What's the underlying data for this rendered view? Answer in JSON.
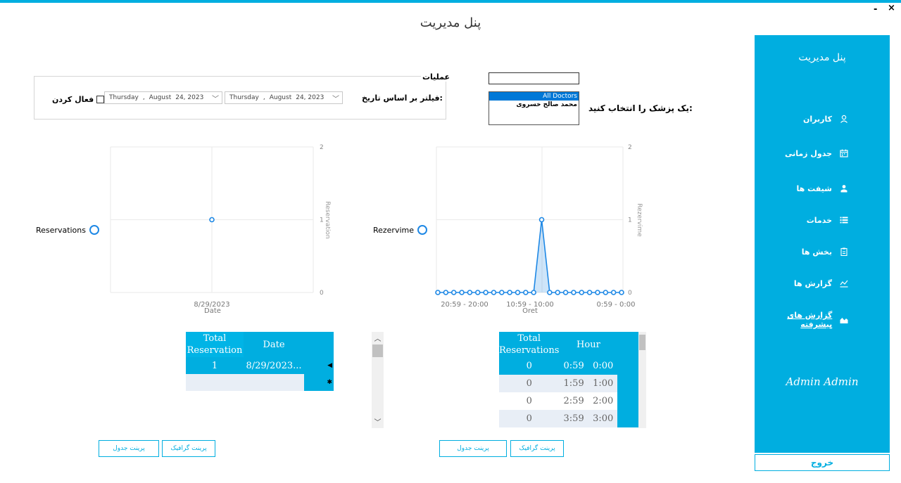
{
  "window": {
    "title": "پنل مدیریت",
    "minimize": "-",
    "close": "×"
  },
  "sidebar": {
    "title": "پنل مدیریت",
    "items": [
      {
        "label": "کاربران",
        "icon": "user-icon"
      },
      {
        "label": "جدول زمانی",
        "icon": "calendar-icon"
      },
      {
        "label": "شیفت ها",
        "icon": "doctor-icon"
      },
      {
        "label": "خدمات",
        "icon": "list-icon"
      },
      {
        "label": "بخش ها",
        "icon": "clipboard-icon"
      },
      {
        "label": "گزارش ها",
        "icon": "line-chart-icon"
      },
      {
        "label": "گزارش های پیشرفته",
        "icon": "area-chart-icon"
      }
    ],
    "user_name": "Admin Admin",
    "logout": "خروج"
  },
  "filter": {
    "legend": "عملیات",
    "label": "فیلتر بر اساس تاریخ:",
    "from": {
      "day": "Thursday",
      "sep": ",",
      "month": "August",
      "date": "24, 2023"
    },
    "to": {
      "day": "Thursday",
      "sep": ",",
      "month": "August",
      "date": "24, 2023"
    },
    "enable_label": "فعال کردن"
  },
  "doctor_select": {
    "label": "یک پزشک را انتخاب کنید:",
    "search_value": "",
    "options": [
      "All Doctors",
      "محمد صالح خسروی"
    ],
    "selected": "All Doctors"
  },
  "chart_data": [
    {
      "type": "scatter",
      "x": [
        "8/29/2023"
      ],
      "y": [
        1
      ],
      "xlabel": "Date",
      "ylabel": "Reservation",
      "ylim": [
        0,
        2
      ],
      "yticks": [
        "0",
        "1",
        "2"
      ],
      "series": [
        {
          "name": "Reservations",
          "values": [
            1
          ]
        }
      ],
      "legend": "left",
      "grid": true
    },
    {
      "type": "area",
      "categories": [
        "20:59 - 20:00",
        "10:59 - 10:00",
        "0:59 - 0:00"
      ],
      "x_labels_shown": [
        "20:59 - 20:00",
        "10:59 - 10:00",
        "0:59 - 0:00"
      ],
      "values": [
        0,
        0,
        0,
        0,
        0,
        0,
        0,
        0,
        0,
        0,
        0,
        0,
        0,
        1,
        0,
        0,
        0,
        0,
        0,
        0,
        0,
        0,
        0,
        0
      ],
      "xlabel": "Oret",
      "ylabel": "Rezervime",
      "ylim": [
        0,
        2
      ],
      "yticks": [
        "0",
        "1",
        "2"
      ],
      "series": [
        {
          "name": "Rezervime",
          "values": [
            0,
            0,
            0,
            0,
            0,
            0,
            0,
            0,
            0,
            0,
            0,
            0,
            0,
            1,
            0,
            0,
            0,
            0,
            0,
            0,
            0,
            0,
            0,
            0
          ]
        }
      ],
      "legend": "left",
      "grid": true
    }
  ],
  "table_left": {
    "headers": [
      "Total\nReservation",
      "Date"
    ],
    "rows": [
      [
        "1",
        "8/29/2023..."
      ]
    ]
  },
  "table_right": {
    "headers": [
      "Total\nReservations",
      "Hour"
    ],
    "rows": [
      [
        "0",
        "0:59   0:00"
      ],
      [
        "0",
        "1:59   1:00"
      ],
      [
        "0",
        "2:59   2:00"
      ],
      [
        "0",
        "3:59   3:00"
      ]
    ]
  },
  "buttons": {
    "print_table": "پرینت جدول",
    "print_chart": "پرینت گرافیک"
  },
  "colors": {
    "accent": "#00aee0",
    "series": "#1e88e5",
    "selection": "#0078d7"
  }
}
